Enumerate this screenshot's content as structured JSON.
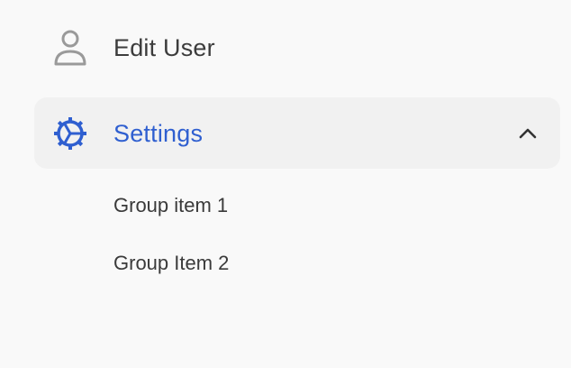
{
  "nav": {
    "items": [
      {
        "label": "Edit User",
        "icon": "user-icon",
        "active": false
      },
      {
        "label": "Settings",
        "icon": "gear-icon",
        "active": true,
        "expanded": true,
        "toggle_icon": "chevron-up-icon"
      }
    ],
    "subitems": [
      {
        "label": "Group item 1"
      },
      {
        "label": "Group Item 2"
      }
    ]
  },
  "colors": {
    "background": "#f9f9f9",
    "active_background": "#f1f1f1",
    "accent": "#2f5fd0",
    "text": "#3c3c3c",
    "muted_icon": "#9a9a9a"
  }
}
